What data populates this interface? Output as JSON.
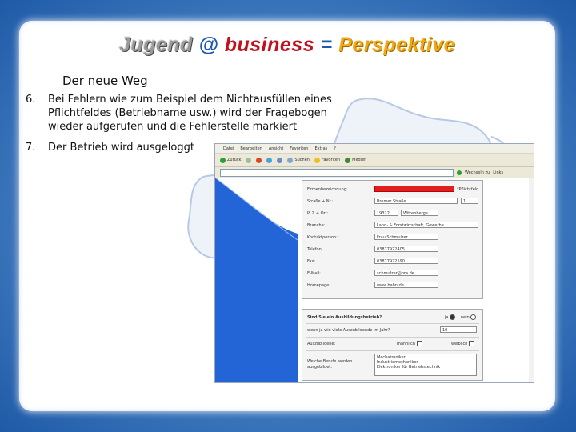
{
  "slide": {
    "title_part1": "Jugend",
    "title_part2": "@",
    "title_part3": "business",
    "title_part4": "=",
    "title_part5": "Perspektive",
    "subtitle": "Der neue Weg",
    "items": [
      {
        "num": "6.",
        "text": "Bei Fehlern wie zum Beispiel dem Nichtausfüllen eines Pflichtfeldes (Betriebname usw.) wird der Fragebogen wieder aufgerufen und die Fehlerstelle markiert"
      },
      {
        "num": "7.",
        "text": "Der Betrieb wird ausgeloggt"
      }
    ]
  },
  "browser": {
    "menu": [
      "Datei",
      "Bearbeiten",
      "Ansicht",
      "Favoriten",
      "Extras",
      "?"
    ],
    "toolbar": [
      "Zurück",
      "Suchen",
      "Favoriten",
      "Medien"
    ],
    "go_label": "Wechseln zu",
    "links_label": "Links",
    "form1": {
      "firmenbezeichnung_label": "Firmenbezeichnung:",
      "firmenbezeichnung_error": "*Pflichtfeld",
      "strasse_label": "Straße + Nr.:",
      "strasse_value": "Bremer Straße",
      "hausnr_value": "1",
      "plz_label": "PLZ + Ort:",
      "plz_value": "19322",
      "ort_value": "Wittenberge",
      "branche_label": "Branche:",
      "branche_value": "Land- & Forstwirtschaft, Gewerbe",
      "kontakt_label": "Kontaktperson:",
      "kontakt_value": "Frau Schmulzer",
      "telefon_label": "Telefon:",
      "telefon_value": "03877972405",
      "fax_label": "Fax:",
      "fax_value": "03877972590",
      "email_label": "E-Mail:",
      "email_value": "schmulzer@bra.de",
      "homepage_label": "Homepage:",
      "homepage_value": "www.bahn.de"
    },
    "form2": {
      "ausbildungsbetrieb_label": "Sind Sie ein Ausbildungsbetrieb?",
      "ja_label": "ja",
      "nein_label": "nein",
      "azubis_jahr_label": "wenn ja wie viele Auszubildende im Jahr?",
      "azubis_jahr_value": "10",
      "auszubildene_label": "Auszubildene:",
      "maennlich_label": "männlich",
      "weiblich_label": "weiblich",
      "berufe_label": "Welche Berufe werden ausgebildet:",
      "berufe_values": [
        "Mechatroniker",
        "Industriemechaniker",
        "Elektroniker für Betriebstechnik"
      ]
    }
  }
}
